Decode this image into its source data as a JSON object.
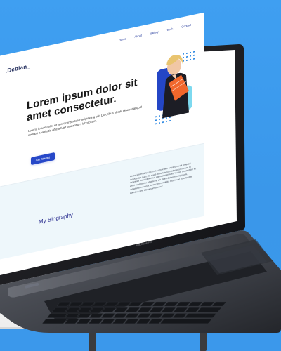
{
  "site": {
    "brand": ".Debian_",
    "nav": [
      "Home",
      "About",
      "gallery",
      "work",
      "Contact"
    ],
    "hero_title": "Lorem ipsum dolor sit amet consectetur.",
    "hero_copy": "Lorem, ipsum dolor sit amet consectetur adipisicing elit. Doloribus id odit placeat aliquid corrupti a veritatis officia fugit laudantium laborosam.",
    "cta_label": "Get Started",
    "bio_title": "My Biography",
    "bio_copy": "Lorem ipsum dolor sit amet consectetur adipisicing elit. Adipisci recusandae quos. Sit quod atque laborum laboriosam rerum. In molestias earum doloribus eaque perspiciatis? Lorem ipsum dolor sit amet consectetur adipisicing elit. Nulla dolorem perspiciatis, voluptatibus eveniet facere totam mollitia modi quae repellendus doloribus sint, laboriosam earum?"
  },
  "device": {
    "brand_label": "MacBook Pro"
  },
  "colors": {
    "background": "#3c9cf0",
    "primary": "#2748c8",
    "accent": "#18b7e8",
    "band": "#eef7fb",
    "text": "#181818"
  },
  "icons": {
    "laptop": "laptop-icon",
    "person": "profile-photo",
    "dots": "dot-pattern-icon"
  }
}
